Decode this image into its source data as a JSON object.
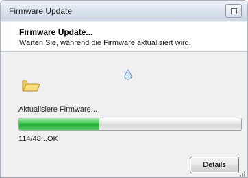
{
  "window": {
    "title": "Firmware Update"
  },
  "header": {
    "title": "Firmware Update...",
    "subtitle": "Warten Sie, während die Firmware aktualisiert wird."
  },
  "status": {
    "label": "Aktualisiere Firmware...",
    "progress_fraction": 0.36,
    "progress_text": "114/48...OK"
  },
  "buttons": {
    "details_label": "Details"
  },
  "icons": [
    "folder-icon",
    "drop-icon",
    "restore-icon",
    "size-grip-icon"
  ],
  "colors": {
    "progress_fill": "#2fbd42",
    "header_background": "#ffffff",
    "body_background": "#f0f0f0"
  }
}
